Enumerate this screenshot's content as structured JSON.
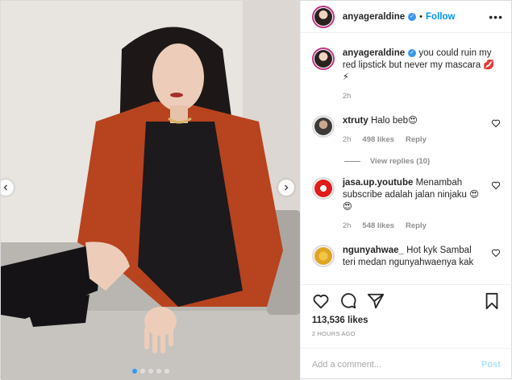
{
  "post": {
    "author": "anyageraldine",
    "separator": "•",
    "follow_label": "Follow",
    "more_label": "•••",
    "caption": {
      "username": "anyageraldine",
      "text": "you could ruin my red lipstick but never my mascara 💋⚡",
      "time": "2h"
    },
    "likes": "113,536 likes",
    "posted_time": "2 HOURS AGO",
    "carousel": {
      "slides": 5,
      "active": 0
    }
  },
  "comments": [
    {
      "username": "xtruty",
      "text": "Halo beb😍",
      "time": "2h",
      "likes": "498 likes",
      "reply_label": "Reply",
      "view_replies": "View replies (10)"
    },
    {
      "username": "jasa.up.youtube",
      "text": "Menambah subscribe adalah jalan ninjaku 😍😍",
      "time": "2h",
      "likes": "548 likes",
      "reply_label": "Reply"
    },
    {
      "username": "ngunyahwae_",
      "text": "Hot kyk Sambal teri medan ngunyahwaenya kak",
      "time": "",
      "likes": "",
      "reply_label": ""
    }
  ],
  "add_comment": {
    "placeholder": "Add a comment...",
    "post_label": "Post"
  },
  "colors": {
    "accent": "#0095f6",
    "verified": "#3897f0",
    "muted": "#8e8e8e",
    "post_disabled": "#b2dffc"
  },
  "icons": [
    "verified-badge-icon",
    "more-options-icon",
    "heart-icon",
    "comment-icon",
    "share-icon",
    "bookmark-icon",
    "chevron-left-icon",
    "chevron-right-icon"
  ]
}
